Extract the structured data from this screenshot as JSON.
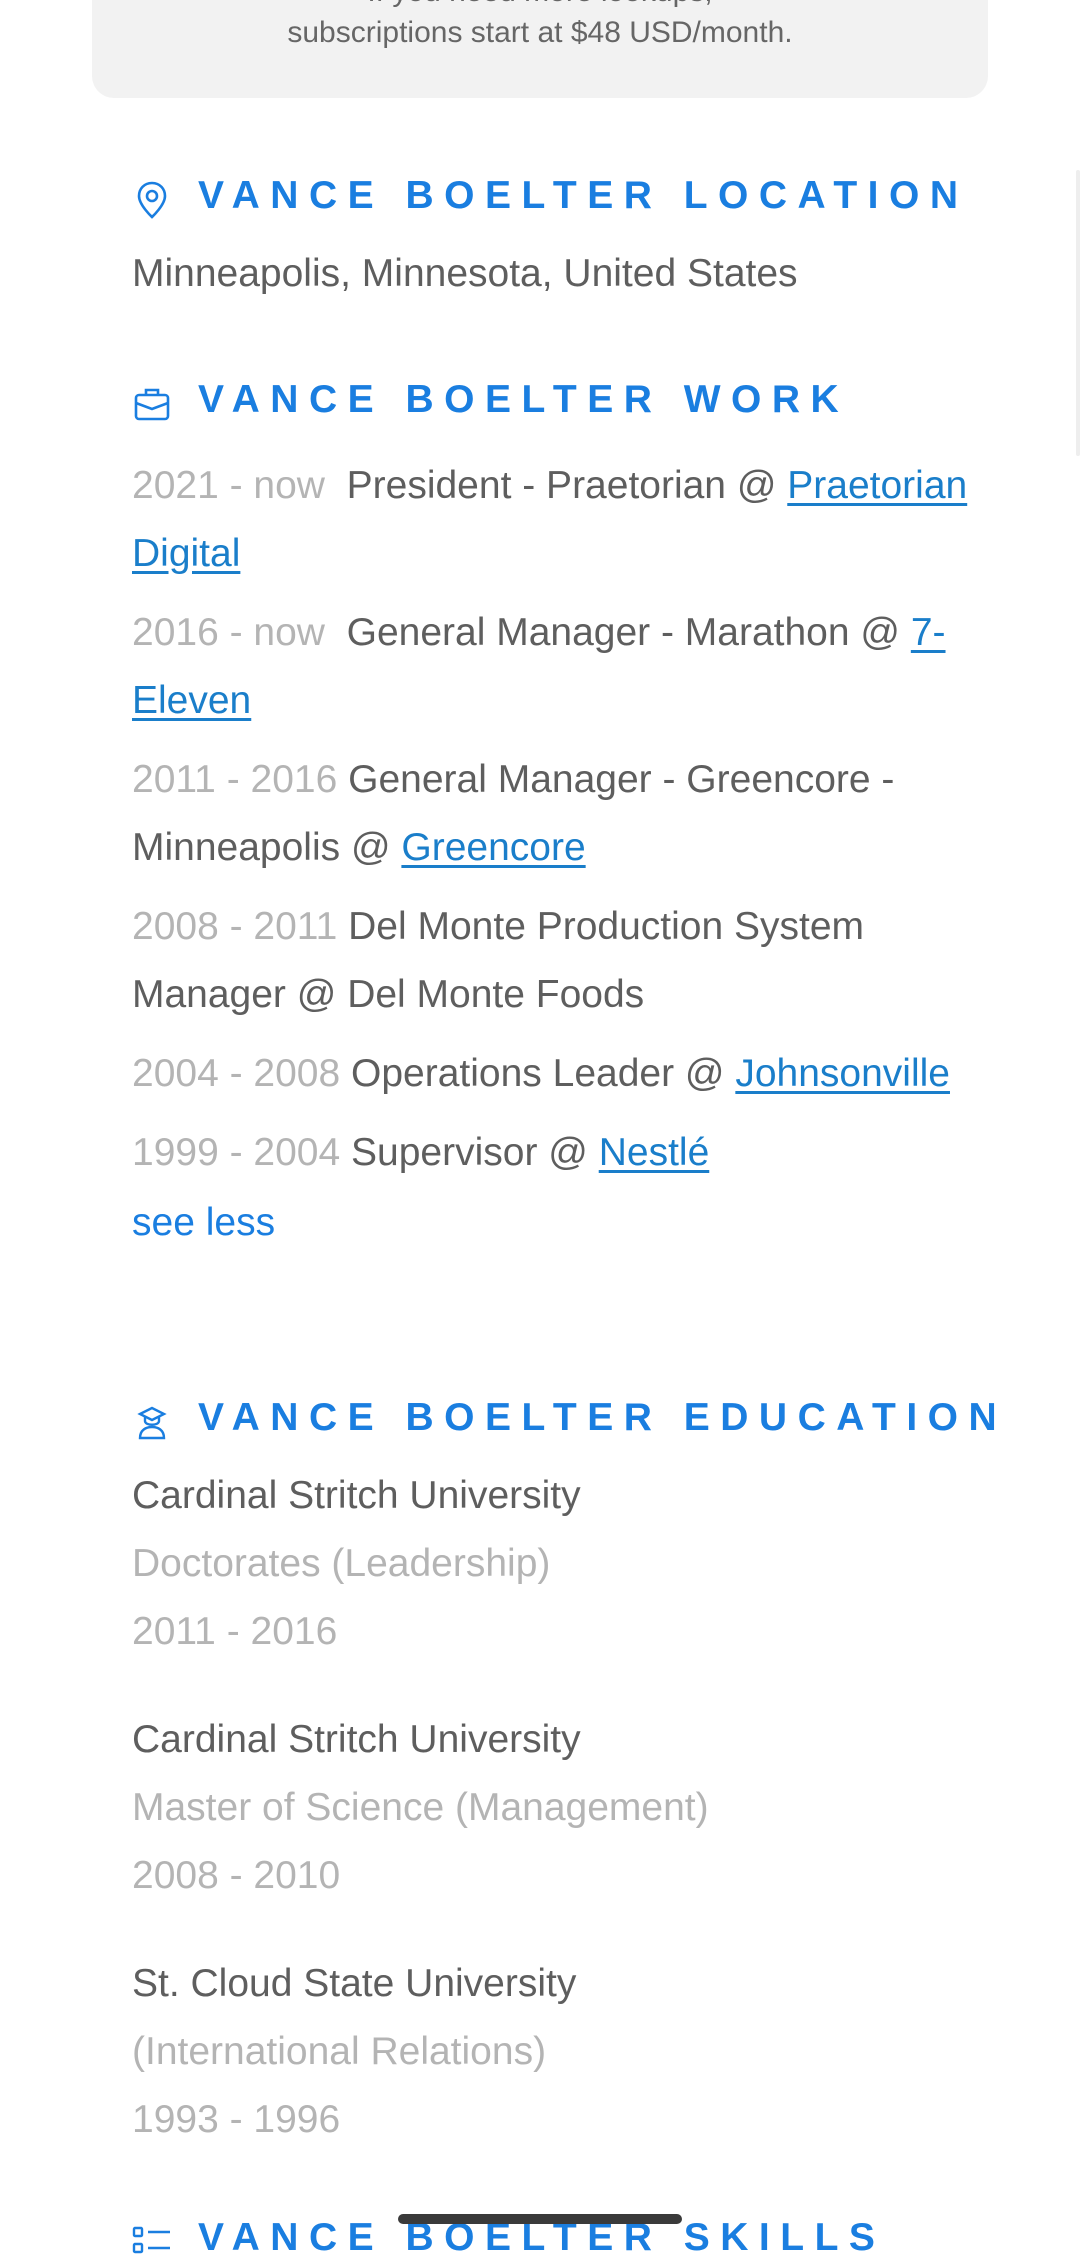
{
  "banner": {
    "line1": "If you need more lookups,",
    "line2": "subscriptions start at $48 USD/month."
  },
  "location": {
    "title": "VANCE BOELTER LOCATION",
    "icon": "map-pin-icon",
    "value": "Minneapolis, Minnesota, United States"
  },
  "work": {
    "title": "VANCE BOELTER WORK",
    "icon": "briefcase-icon",
    "items": [
      {
        "years": "2021 - now",
        "role": "President - Praetorian @ ",
        "company": "Praetorian Digital",
        "company_link": true
      },
      {
        "years": "2016 - now",
        "role": "General Manager - Marathon @ ",
        "company": "7-Eleven",
        "company_link": true
      },
      {
        "years": "2011 - 2016",
        "role": "General Manager - Greencore - Minneapolis @ ",
        "company": "Greencore",
        "company_link": true
      },
      {
        "years": "2008 - 2011",
        "role": "Del Monte Production System Manager @ ",
        "company": "Del Monte Foods",
        "company_link": false
      },
      {
        "years": "2004 - 2008",
        "role": "Operations Leader @ ",
        "company": "Johnsonville",
        "company_link": true
      },
      {
        "years": "1999 - 2004",
        "role": "Supervisor @ ",
        "company": "Nestlé",
        "company_link": true
      }
    ],
    "see_less": "see less"
  },
  "education": {
    "title": "VANCE BOELTER EDUCATION",
    "icon": "graduate-icon",
    "items": [
      {
        "school": "Cardinal Stritch University",
        "degree": "Doctorates (Leadership)",
        "years": "2011 - 2016"
      },
      {
        "school": "Cardinal Stritch University",
        "degree": "Master of Science (Management)",
        "years": "2008 - 2010"
      },
      {
        "school": "St. Cloud State University",
        "degree": "(International Relations)",
        "years": "1993 - 1996"
      }
    ]
  },
  "skills": {
    "title": "VANCE BOELTER SKILLS",
    "icon": "list-icon"
  },
  "colors": {
    "accent": "#1a7ee0",
    "link": "#1a7eca",
    "text": "#5e5e5e",
    "muted": "#b4b4b4"
  }
}
